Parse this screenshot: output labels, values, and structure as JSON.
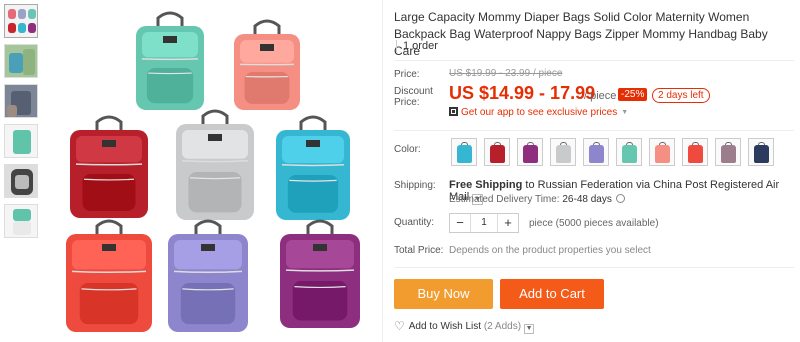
{
  "thumbnails": [
    {
      "name": "thumb-1",
      "colors": [
        "#e56b7a",
        "#9aa3c7",
        "#67c5b4",
        "#c8242d"
      ]
    },
    {
      "name": "thumb-2",
      "colors": [
        "#4aa0b8",
        "#8fb37f"
      ]
    },
    {
      "name": "thumb-3",
      "colors": [
        "#566072",
        "#9c8d83"
      ]
    },
    {
      "name": "thumb-4",
      "colors": [
        "#5fc4a9"
      ]
    },
    {
      "name": "thumb-5",
      "colors": [
        "#444",
        "#bbb"
      ]
    },
    {
      "name": "thumb-6",
      "colors": [
        "#5fc4a9",
        "#e9e9e9"
      ]
    }
  ],
  "main_image_bags": [
    {
      "color": "#66c7b0",
      "label": "mint"
    },
    {
      "color": "#f58f84",
      "label": "pink"
    },
    {
      "color": "#b7202b",
      "label": "red"
    },
    {
      "color": "#c9cacc",
      "label": "gray"
    },
    {
      "color": "#35b7d1",
      "label": "sky-blue"
    },
    {
      "color": "#ee4a3d",
      "label": "watermelon"
    },
    {
      "color": "#8d86cd",
      "label": "lavender"
    },
    {
      "color": "#8d2f7e",
      "label": "purple"
    }
  ],
  "product": {
    "title": "Large Capacity Mommy Diaper Bags Solid Color Maternity Women Backpack Bag Waterproof Nappy Bags Zipper Mommy Handbag Baby Care",
    "orders": "1 order"
  },
  "pricing": {
    "price_label": "Price:",
    "original_price": "US $19.99 - 23.99 / piece",
    "discount_label": "Discount Price:",
    "discount_price": "US $14.99 - 17.99",
    "per_piece": "/ piece",
    "discount_pct": "-25%",
    "days_left": "2 days left",
    "app_promo": "Get our app to see exclusive prices",
    "accent_color": "#e62e04"
  },
  "color_option": {
    "label": "Color:",
    "swatches": [
      {
        "color": "#35b7d1"
      },
      {
        "color": "#b7202b"
      },
      {
        "color": "#8d2f7e"
      },
      {
        "color": "#c9cacc"
      },
      {
        "color": "#8d86cd"
      },
      {
        "color": "#66c7b0"
      },
      {
        "color": "#f58f84"
      },
      {
        "color": "#ee4a3d"
      },
      {
        "color": "#9b7d8c"
      },
      {
        "color": "#2c3a5e"
      }
    ]
  },
  "shipping": {
    "label": "Shipping:",
    "free": "Free Shipping",
    "destination": "to Russian Federation via China Post Registered Air Mail",
    "estimated_label": "Estimated Delivery Time:",
    "estimated_days": "26-48 days"
  },
  "quantity": {
    "label": "Quantity:",
    "minus": "−",
    "value": "1",
    "plus": "+",
    "available": "piece (5000 pieces available)"
  },
  "total": {
    "label": "Total Price:",
    "value": "Depends on the product properties you select"
  },
  "actions": {
    "buy_now": "Buy Now",
    "add_to_cart": "Add to Cart",
    "wishlist": "Add to Wish List",
    "wishlist_adds": "(2 Adds)",
    "buy_color": "#f29b2f",
    "cart_color": "#f45a18"
  }
}
